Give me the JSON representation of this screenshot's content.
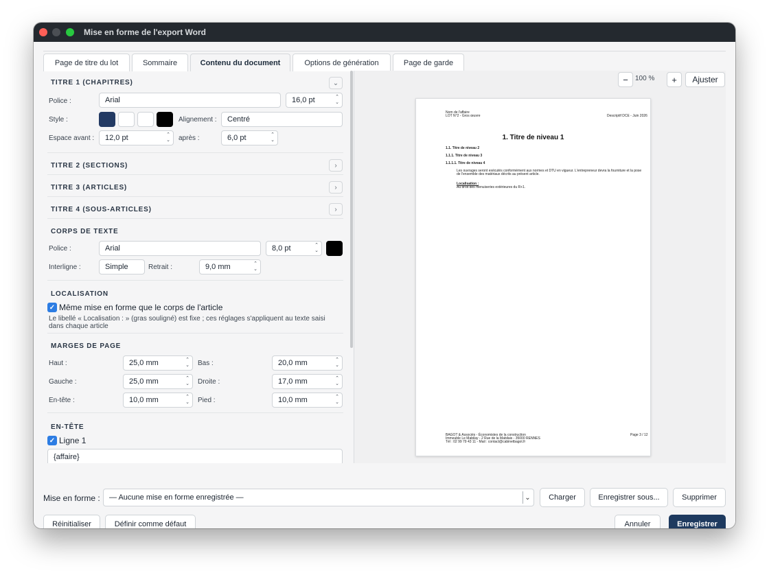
{
  "window": {
    "title": "Mise en forme de l'export Word"
  },
  "tabs": [
    {
      "label": "Page de titre du lot"
    },
    {
      "label": "Sommaire"
    },
    {
      "label": "Contenu du document",
      "active": true
    },
    {
      "label": "Options de génération"
    },
    {
      "label": "Page de garde"
    }
  ],
  "titre1": {
    "heading": "TITRE 1 (CHAPITRES)",
    "police_label": "Police :",
    "police": "Arial",
    "size": "16,0 pt",
    "style_label": "Style :",
    "alignement_label": "Alignement :",
    "alignement": "Centré",
    "avant_label": "Espace avant :",
    "avant": "12,0 pt",
    "apres_label": "après :",
    "apres": "6,0 pt"
  },
  "sections": {
    "titre2": "TITRE 2 (SECTIONS)",
    "titre3": "TITRE 3 (ARTICLES)",
    "titre4": "TITRE 4 (SOUS-ARTICLES)"
  },
  "corps": {
    "heading": "CORPS DE TEXTE",
    "police_label": "Police :",
    "police": "Arial",
    "size": "8,0 pt",
    "interligne_label": "Interligne :",
    "interligne": "Simple",
    "retrait_label": "Retrait :",
    "retrait": "9,0 mm"
  },
  "localisation": {
    "heading": "LOCALISATION",
    "checkbox_label": "Même mise en forme que le corps de l'article",
    "note_line1": "Le libellé « Localisation : » (gras souligné) est fixe ; ces réglages s'appliquent au texte saisi",
    "note_line2": "dans chaque article"
  },
  "marges": {
    "heading": "MARGES DE PAGE",
    "haut_label": "Haut :",
    "haut": "25,0 mm",
    "bas_label": "Bas :",
    "bas": "20,0 mm",
    "gauche_label": "Gauche :",
    "gauche": "25,0 mm",
    "droite_label": "Droite :",
    "droite": "17,0 mm",
    "entete_label": "En-tête :",
    "entete": "10,0 mm",
    "pied_label": "Pied :",
    "pied": "10,0 mm"
  },
  "entete": {
    "heading": "EN-TÊTE",
    "ligne1_label": "Ligne 1",
    "ligne1_value": "{affaire}"
  },
  "preview": {
    "zoom_minus": "−",
    "zoom_value": "100 %",
    "zoom_plus": "+",
    "fit": "Ajuster",
    "header_left_1": "Nom de l'affaire",
    "header_left_2": "LOT N°2 - Gros œuvre",
    "header_right": "Descriptif DCE - Juin 2026",
    "h1": "1. Titre de niveau 1",
    "h2": "1.1. Titre de niveau 2",
    "h3": "1.1.1. Titre de niveau 3",
    "h4": "1.1.1.1. Titre de niveau 4",
    "body_1": "Les ouvrages seront exécutés conformément aux normes et DTU en vigueur. L'entrepreneur devra la fourniture et la pose",
    "body_2": "de l'ensemble des matériaux décrits au présent article.",
    "loc_label": "Localisation :",
    "loc_text": "Au droit des menuiseries extérieures du R+1.",
    "footer_1": "BAGOT & Associés - Économistes de la construction",
    "footer_2": "Immeuble Le Mabilay - 2 Rue de la Mabilais - 35000 RENNES",
    "footer_3": "Tél : 02 99 79 43 11 - Mail : contact@cabinetbagot.fr",
    "footer_page": "Page 3 / 12"
  },
  "bottom": {
    "mise_en_forme_label": "Mise en forme :",
    "select_value": "— Aucune mise en forme enregistrée —",
    "charger": "Charger",
    "enregistrer_sous": "Enregistrer sous...",
    "supprimer": "Supprimer",
    "reinitialiser": "Réinitialiser",
    "definir_defaut": "Définir comme défaut",
    "annuler": "Annuler",
    "enregistrer": "Enregistrer"
  },
  "colors": {
    "accent": "#1e3a5f",
    "swatch_navy": "#233a63",
    "swatch_black": "#000000",
    "checkbox": "#2d7de3",
    "titlebar": "#24292f"
  },
  "icons": [
    "chevron-down-icon",
    "chevron-right-icon",
    "checkmark-icon",
    "stepper-icon"
  ]
}
